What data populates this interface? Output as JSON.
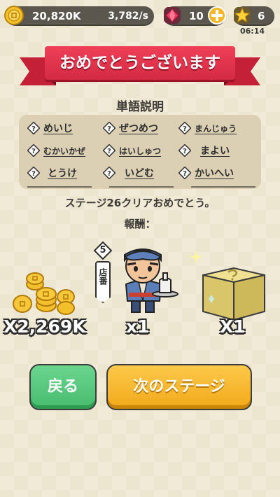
{
  "top_bar": {
    "coins": "20,820K",
    "coin_rate": "3,782/s",
    "gems": "10",
    "stars": "6",
    "time": "06:14"
  },
  "banner": {
    "title": "おめでとうございます"
  },
  "vocab": {
    "heading": "単語説明",
    "words": [
      "めいじ",
      "ぜつめつ",
      "まんじゅう",
      "むかいかぜ",
      "はいしゅつ",
      "まよい",
      "とうけ",
      "いどむ",
      "かいへい"
    ]
  },
  "result": {
    "message": "ステージ26クリアおめでとう。",
    "rewards_heading": "報酬：",
    "coin_reward": "X2,269K",
    "staff_reward": "x1",
    "box_reward": "X1",
    "staff_level": "5",
    "staff_role": "店番"
  },
  "buttons": {
    "back": "戻る",
    "next": "次のステージ"
  },
  "colors": {
    "background": "#f1ead6",
    "banner_red": "#e23a51",
    "back_green": "#5cc97e",
    "next_yellow": "#f5b324",
    "pill_bg": "#5b564e"
  },
  "icons": [
    "coin-icon",
    "gem-icon",
    "add-icon",
    "star-icon",
    "question-icon",
    "coin-stack-icon",
    "staff-character",
    "mystery-box-icon"
  ]
}
